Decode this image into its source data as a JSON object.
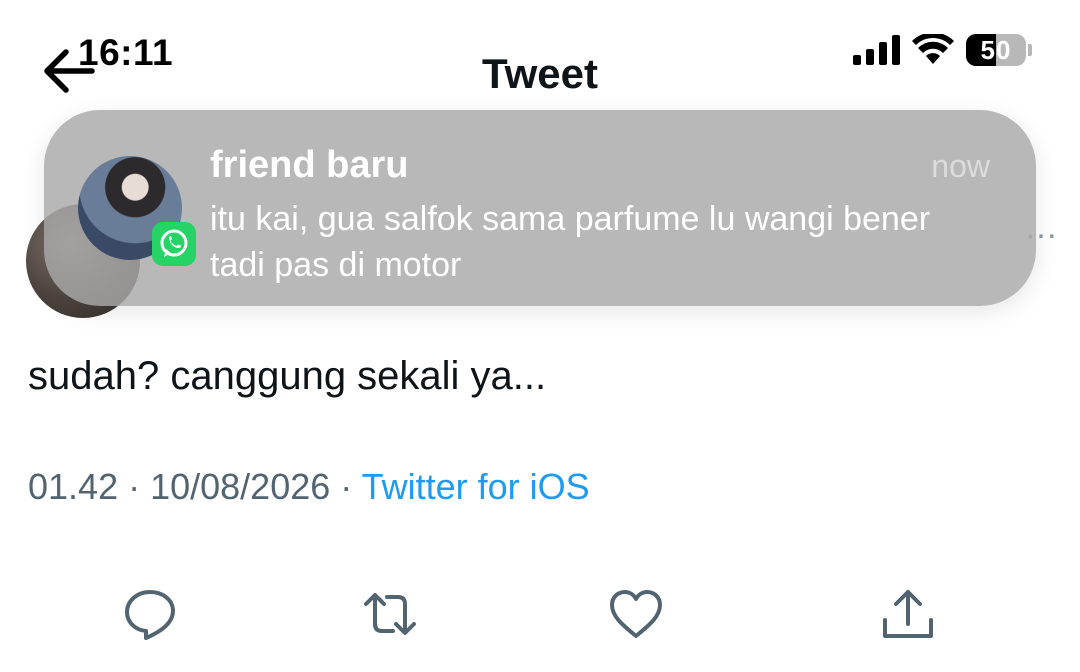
{
  "status_bar": {
    "time": "16:11",
    "battery_level": "50",
    "battery_fraction": 0.5,
    "icons": [
      "signal-icon",
      "wifi-icon",
      "battery-icon"
    ]
  },
  "nav": {
    "title": "Tweet",
    "back_icon": "back-arrow-icon"
  },
  "notification": {
    "app_icon": "whatsapp-icon",
    "sender": "friend baru",
    "time": "now",
    "message": "itu kai, gua salfok sama parfume lu wangi bener tadi pas di motor"
  },
  "tweet": {
    "more_label": "…",
    "text": "sudah? canggung sekali ya...",
    "time": "01.42",
    "separator": " · ",
    "date": "10/08/2026",
    "source": "Twitter for iOS"
  },
  "actions": {
    "icons": [
      "reply-icon",
      "retweet-icon",
      "like-icon",
      "share-icon"
    ]
  },
  "colors": {
    "text": "#0f1419",
    "meta": "#536471",
    "link": "#1d9bf0",
    "icon": "#536471",
    "notification_bg": "#a8a8a8",
    "whatsapp": "#25d366"
  }
}
